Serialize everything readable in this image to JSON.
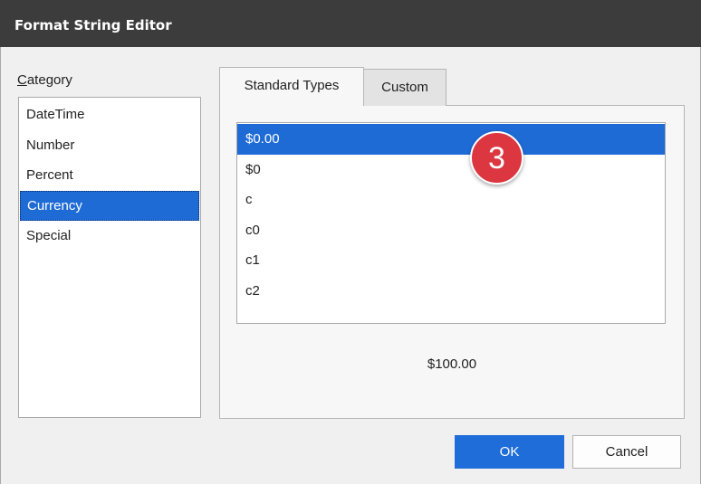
{
  "window": {
    "title": "Format String Editor"
  },
  "category": {
    "label_accel": "C",
    "label_rest": "ategory",
    "items": [
      {
        "label": "DateTime"
      },
      {
        "label": "Number"
      },
      {
        "label": "Percent"
      },
      {
        "label": "Currency"
      },
      {
        "label": "Special"
      }
    ],
    "selected": "Currency"
  },
  "tabs": [
    {
      "label": "Standard Types",
      "active": true
    },
    {
      "label": "Custom",
      "active": false
    }
  ],
  "standard_types": {
    "items": [
      {
        "label": "$0.00"
      },
      {
        "label": "$0"
      },
      {
        "label": "c"
      },
      {
        "label": "c0"
      },
      {
        "label": "c1"
      },
      {
        "label": "c2"
      }
    ],
    "selected": "$0.00"
  },
  "preview": {
    "text": "$100.00"
  },
  "callout": {
    "number": "3",
    "color": "#dc3741"
  },
  "buttons": {
    "ok": "OK",
    "cancel": "Cancel"
  },
  "colors": {
    "selection": "#1e6bd6",
    "titlebar": "#3c3c3c",
    "ok_button": "#1f6dd8"
  }
}
